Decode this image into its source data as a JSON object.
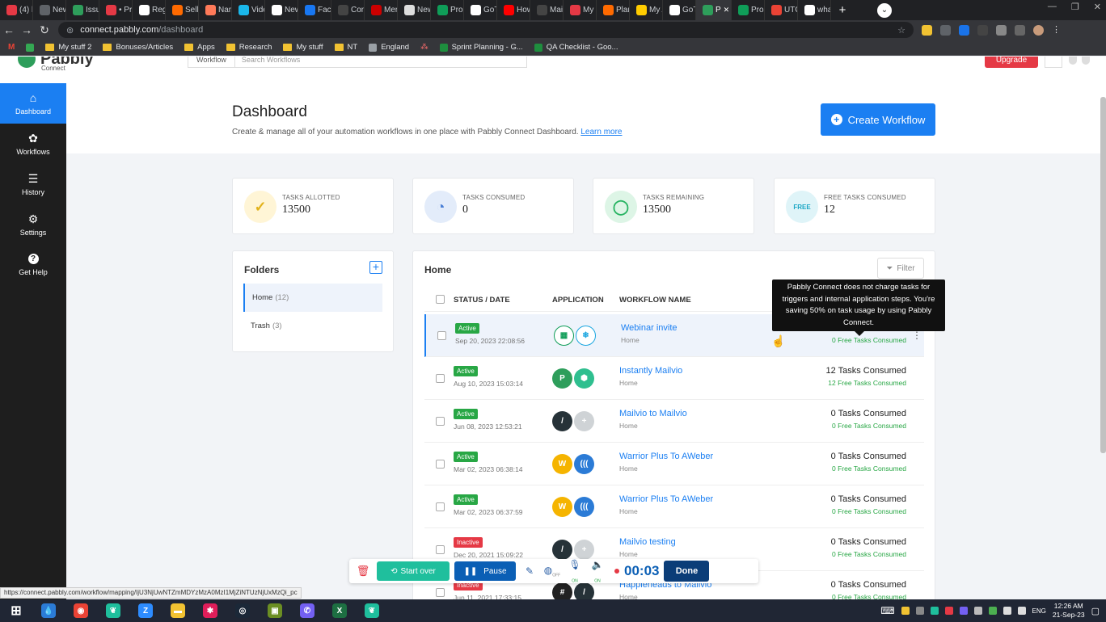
{
  "browser": {
    "tabs": [
      {
        "label": "(4) k",
        "color": "#e53945"
      },
      {
        "label": "New",
        "color": "#5f6368"
      },
      {
        "label": "Issue",
        "color": "#2e9e5b"
      },
      {
        "label": "• Pro",
        "color": "#e53945"
      },
      {
        "label": "Regi",
        "color": "#ffffff"
      },
      {
        "label": "Selle",
        "color": "#ff6a00"
      },
      {
        "label": "Nam",
        "color": "#ff7a59"
      },
      {
        "label": "Vide",
        "color": "#1ab7ea"
      },
      {
        "label": "New",
        "color": "#ffffff"
      },
      {
        "label": "Face",
        "color": "#1877f2"
      },
      {
        "label": "Conv",
        "color": "#444444"
      },
      {
        "label": "Mem",
        "color": "#cc0000"
      },
      {
        "label": "New",
        "color": "#dddddd"
      },
      {
        "label": "Proc",
        "color": "#0f9d58"
      },
      {
        "label": "GoTo",
        "color": "#ffffff"
      },
      {
        "label": "How",
        "color": "#ff0000"
      },
      {
        "label": "Mail",
        "color": "#444444"
      },
      {
        "label": "My Z",
        "color": "#e53945"
      },
      {
        "label": "Plans",
        "color": "#ff6a00"
      },
      {
        "label": "My A",
        "color": "#ffcc00"
      },
      {
        "label": "GoTo",
        "color": "#ffffff"
      },
      {
        "label": "P",
        "color": "#2e9e5b",
        "active": true
      },
      {
        "label": "Pros",
        "color": "#0f9d58"
      },
      {
        "label": "UTC",
        "color": "#ea4335"
      },
      {
        "label": "what",
        "color": "#ffffff"
      }
    ],
    "url_host": "connect.pabbly.com",
    "url_path": "/dashboard",
    "bookmarks": [
      {
        "label": "My stuff 2",
        "kind": "folder"
      },
      {
        "label": "Bonuses/Articles",
        "kind": "folder"
      },
      {
        "label": "Apps",
        "kind": "folder"
      },
      {
        "label": "Research",
        "kind": "folder"
      },
      {
        "label": "My stuff",
        "kind": "folder"
      },
      {
        "label": "NT",
        "kind": "folder"
      },
      {
        "label": "England",
        "kind": "site"
      },
      {
        "label": "",
        "kind": "asana"
      },
      {
        "label": "Sprint Planning - G...",
        "kind": "sheet"
      },
      {
        "label": "QA Checklist - Goo...",
        "kind": "sheet"
      }
    ],
    "status_url": "https://connect.pabbly.com/workflow/mapping/IjU3NjUwNTZmMDYzMzA0MzI1MjZiNTUzNjUxMzQi_pc"
  },
  "header": {
    "logo_word": "Pabbly",
    "logo_sub": "Connect",
    "search_tab": "Workflow",
    "search_placeholder": "Search Workflows",
    "upgrade_label": "Upgrade"
  },
  "sidebar": {
    "items": [
      {
        "label": "Dashboard",
        "icon": "home-icon",
        "glyph": "⌂",
        "active": true
      },
      {
        "label": "Workflows",
        "icon": "workflow-icon",
        "glyph": "✿"
      },
      {
        "label": "History",
        "icon": "list-icon",
        "glyph": "☰"
      },
      {
        "label": "Settings",
        "icon": "gear-icon",
        "glyph": "⚙"
      },
      {
        "label": "Get Help",
        "icon": "help-icon",
        "glyph": "?"
      }
    ]
  },
  "page": {
    "title": "Dashboard",
    "subtitle": "Create & manage all of your automation workflows in one place with Pabbly Connect Dashboard.",
    "learn_more": "Learn more",
    "create_button": "Create Workflow"
  },
  "stats": [
    {
      "label": "TASKS ALLOTTED",
      "value": "13500",
      "bg": "#fff5d6",
      "fg": "#e2b21b",
      "glyph": "✓"
    },
    {
      "label": "TASKS CONSUMED",
      "value": "0",
      "bg": "#e3ecfa",
      "fg": "#4a7fd6",
      "glyph": "◔"
    },
    {
      "label": "TASKS REMAINING",
      "value": "13500",
      "bg": "#ddf5e6",
      "fg": "#28b463",
      "glyph": "◯"
    },
    {
      "label": "FREE TASKS CONSUMED",
      "value": "12",
      "bg": "#dff4f8",
      "fg": "#1aa6c4",
      "glyph": "FREE"
    }
  ],
  "folders": {
    "title": "Folders",
    "items": [
      {
        "name": "Home",
        "count": "(12)",
        "active": true
      },
      {
        "name": "Trash",
        "count": "(3)"
      }
    ]
  },
  "workflows": {
    "title": "Home",
    "filter_label": "Filter",
    "columns": {
      "status": "STATUS / DATE",
      "application": "APPLICATION",
      "name": "WORKFLOW NAME"
    },
    "rows": [
      {
        "status": "Active",
        "date": "Sep 20, 2023 22:08:56",
        "name": "Webinar invite",
        "folder": "Home",
        "tasks": "",
        "free": "0 Free Tasks Consumed",
        "apps": [
          {
            "c": "#0f9d58",
            "g": "▦"
          },
          {
            "c": "#1aa6e0",
            "g": "❄"
          }
        ]
      },
      {
        "status": "Active",
        "date": "Aug 10, 2023 15:03:14",
        "name": "Instantly Mailvio",
        "folder": "Home",
        "tasks": "12 Tasks Consumed",
        "free": "12 Free Tasks Consumed",
        "apps": [
          {
            "c": "#2e9e5b",
            "g": "P"
          },
          {
            "c": "#2fbf8f",
            "g": "⬢"
          }
        ]
      },
      {
        "status": "Active",
        "date": "Jun 08, 2023 12:53:21",
        "name": "Mailvio to Mailvio",
        "folder": "Home",
        "tasks": "0 Tasks Consumed",
        "free": "0 Free Tasks Consumed",
        "apps": [
          {
            "c": "#263238",
            "g": "/"
          },
          {
            "c": "#cfd3d6",
            "g": "+"
          }
        ]
      },
      {
        "status": "Active",
        "date": "Mar 02, 2023 06:38:14",
        "name": "Warrior Plus To AWeber",
        "folder": "Home",
        "tasks": "0 Tasks Consumed",
        "free": "0 Free Tasks Consumed",
        "apps": [
          {
            "c": "#f5b400",
            "g": "W"
          },
          {
            "c": "#2b7bd6",
            "g": "((("
          }
        ]
      },
      {
        "status": "Active",
        "date": "Mar 02, 2023 06:37:59",
        "name": "Warrior Plus To AWeber",
        "folder": "Home",
        "tasks": "0 Tasks Consumed",
        "free": "0 Free Tasks Consumed",
        "apps": [
          {
            "c": "#f5b400",
            "g": "W"
          },
          {
            "c": "#2b7bd6",
            "g": "((("
          }
        ]
      },
      {
        "status": "Inactive",
        "date": "Dec 20, 2021 15:09:22",
        "name": "Mailvio testing",
        "folder": "Home",
        "tasks": "0 Tasks Consumed",
        "free": "0 Free Tasks Consumed",
        "apps": [
          {
            "c": "#263238",
            "g": "/"
          },
          {
            "c": "#cfd3d6",
            "g": "+"
          }
        ]
      },
      {
        "status": "Inactive",
        "date": "Jun 11, 2021 17:33:15",
        "name": "Happierleads to Mailvio",
        "folder": "Home",
        "tasks": "0 Tasks Consumed",
        "free": "0 Free Tasks Consumed",
        "apps": [
          {
            "c": "#222222",
            "g": "#"
          },
          {
            "c": "#263238",
            "g": "/"
          }
        ]
      }
    ]
  },
  "tooltip": "Pabbly Connect does not charge tasks for triggers and internal application steps. You're saving 50% on task usage by using Pabbly Connect.",
  "recorder": {
    "start_over": "Start over",
    "pause": "Pause",
    "timer": "00:03",
    "done": "Done",
    "cam_state": "OFF",
    "mic_state": "ON",
    "sound_state": "ON"
  },
  "taskbar": {
    "apps": [
      {
        "icon": "drop-icon",
        "c": "#2b7bd6",
        "g": "💧"
      },
      {
        "icon": "chrome-icon",
        "c": "#ea4335",
        "g": "◉"
      },
      {
        "icon": "grape-icon",
        "c": "#1fbf9d",
        "g": "❦"
      },
      {
        "icon": "zoom-icon",
        "c": "#2d8cff",
        "g": "Z"
      },
      {
        "icon": "explorer-icon",
        "c": "#f1c232",
        "g": "▬"
      },
      {
        "icon": "slack-icon",
        "c": "#e01e5a",
        "g": "✱"
      },
      {
        "icon": "steam-icon",
        "c": "#1b2838",
        "g": "◎"
      },
      {
        "icon": "camera-icon",
        "c": "#6b8e23",
        "g": "▣"
      },
      {
        "icon": "viber-icon",
        "c": "#7360f2",
        "g": "✆"
      },
      {
        "icon": "excel-icon",
        "c": "#1d6f42",
        "g": "X"
      },
      {
        "icon": "grape-icon-2",
        "c": "#1fbf9d",
        "g": "❦"
      }
    ],
    "lang": "ENG",
    "time": "12:26 AM",
    "date": "21-Sep-23"
  }
}
